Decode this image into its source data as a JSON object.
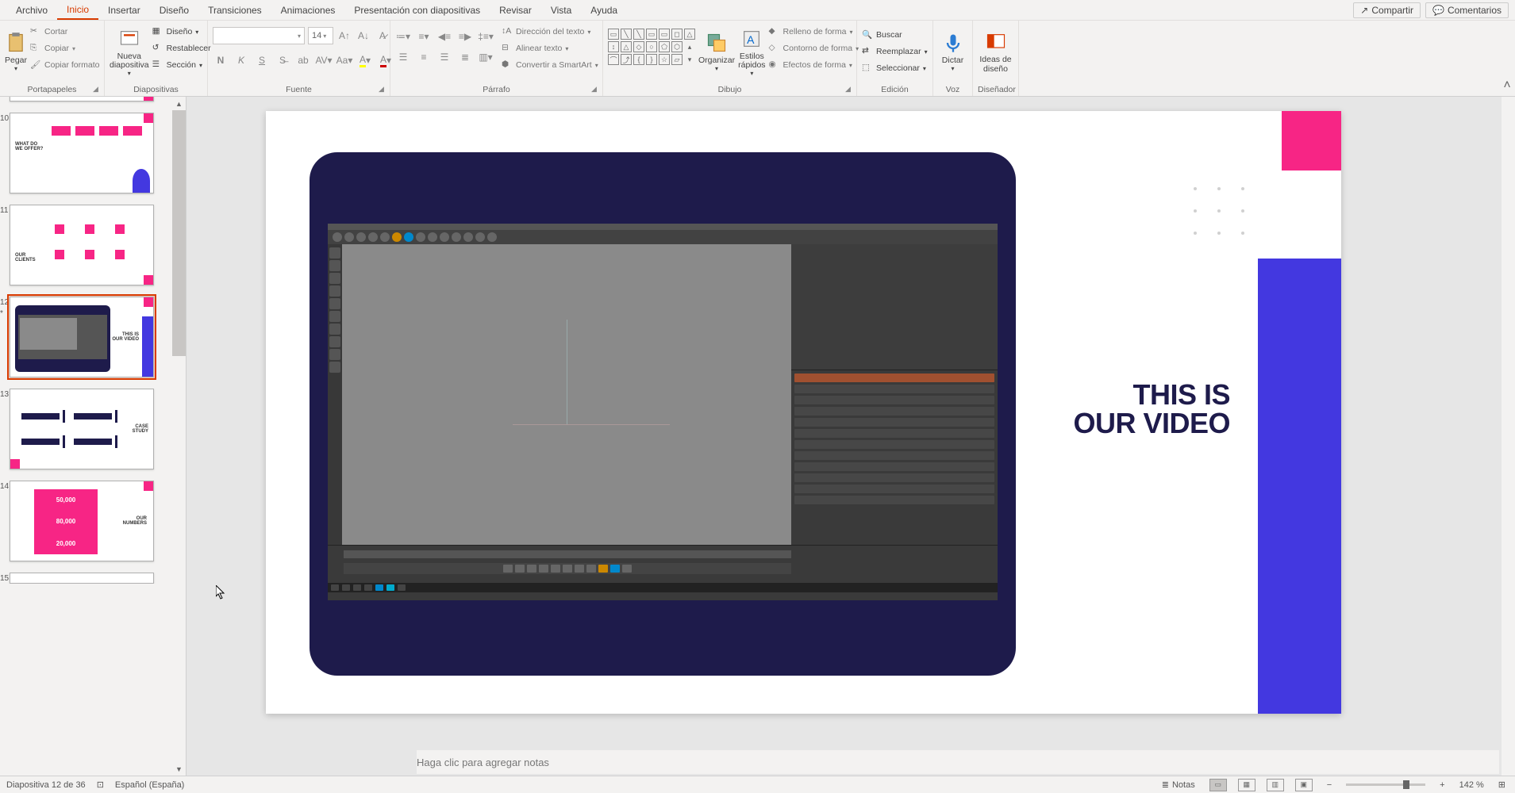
{
  "menu": {
    "tabs": [
      "Archivo",
      "Inicio",
      "Insertar",
      "Diseño",
      "Transiciones",
      "Animaciones",
      "Presentación con diapositivas",
      "Revisar",
      "Vista",
      "Ayuda"
    ],
    "active_index": 1,
    "share": "Compartir",
    "comments": "Comentarios"
  },
  "ribbon": {
    "groups": {
      "clipboard": {
        "label": "Portapapeles",
        "paste": "Pegar",
        "cut": "Cortar",
        "copy": "Copiar",
        "format_painter": "Copiar formato"
      },
      "slides": {
        "label": "Diapositivas",
        "new_slide": "Nueva diapositiva",
        "layout": "Diseño",
        "reset": "Restablecer",
        "section": "Sección"
      },
      "font": {
        "label": "Fuente",
        "size": "14"
      },
      "paragraph": {
        "label": "Párrafo",
        "text_direction": "Dirección del texto",
        "align_text": "Alinear texto",
        "smartart": "Convertir a SmartArt"
      },
      "drawing": {
        "label": "Dibujo",
        "arrange": "Organizar",
        "quick_styles": "Estilos rápidos",
        "shape_fill": "Relleno de forma",
        "shape_outline": "Contorno de forma",
        "shape_effects": "Efectos de forma"
      },
      "editing": {
        "label": "Edición",
        "find": "Buscar",
        "replace": "Reemplazar",
        "select": "Seleccionar"
      },
      "voice": {
        "label": "Voz",
        "dictate": "Dictar"
      },
      "designer": {
        "label": "Diseñador",
        "ideas": "Ideas de diseño"
      }
    }
  },
  "thumbs": {
    "items": [
      {
        "num": "",
        "kind": "partial_top"
      },
      {
        "num": "10",
        "kind": "offer"
      },
      {
        "num": "11",
        "kind": "clients"
      },
      {
        "num": "12",
        "kind": "video",
        "selected": true,
        "title_l1": "THIS IS",
        "title_l2": "OUR VIDEO"
      },
      {
        "num": "13",
        "kind": "case"
      },
      {
        "num": "14",
        "kind": "numbers",
        "n1": "50,000",
        "n2": "80,000",
        "n3": "20,000"
      },
      {
        "num": "15",
        "kind": "partial_bottom"
      }
    ],
    "selected_star": "*"
  },
  "slide": {
    "title_l1": "THIS IS",
    "title_l2": "OUR VIDEO"
  },
  "notes": {
    "placeholder": "Haga clic para agregar notas"
  },
  "status": {
    "slide_counter": "Diapositiva 12 de 36",
    "language": "Español (España)",
    "notes_btn": "Notas",
    "zoom": "142 %"
  }
}
